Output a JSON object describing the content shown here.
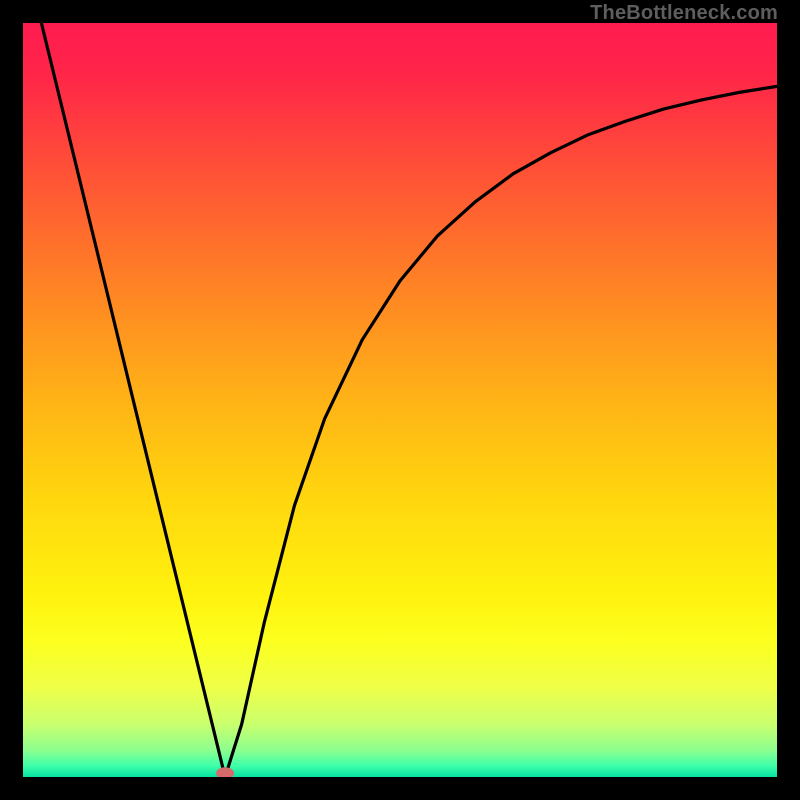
{
  "watermark": "TheBottleneck.com",
  "chart_data": {
    "type": "line",
    "title": "",
    "xlabel": "",
    "ylabel": "",
    "xlim": [
      0,
      1
    ],
    "ylim": [
      0,
      1
    ],
    "grid": false,
    "series": [
      {
        "name": "bottleneck-curve",
        "x": [
          0.0,
          0.05,
          0.1,
          0.15,
          0.2,
          0.25,
          0.268,
          0.29,
          0.32,
          0.36,
          0.4,
          0.45,
          0.5,
          0.55,
          0.6,
          0.65,
          0.7,
          0.75,
          0.8,
          0.85,
          0.9,
          0.95,
          1.0
        ],
        "y": [
          1.1,
          0.895,
          0.69,
          0.484,
          0.279,
          0.074,
          0.0,
          0.07,
          0.205,
          0.36,
          0.475,
          0.58,
          0.658,
          0.718,
          0.763,
          0.8,
          0.828,
          0.852,
          0.87,
          0.886,
          0.898,
          0.908,
          0.916
        ]
      }
    ],
    "marker": {
      "x": 0.268,
      "y": 0.005,
      "color": "#d46a6a",
      "rx": 9,
      "ry": 6
    },
    "gradient_stops": [
      {
        "offset": 0.0,
        "color": "#ff1a4f"
      },
      {
        "offset": 0.07,
        "color": "#ff2648"
      },
      {
        "offset": 0.2,
        "color": "#ff5236"
      },
      {
        "offset": 0.35,
        "color": "#ff8324"
      },
      {
        "offset": 0.5,
        "color": "#ffb316"
      },
      {
        "offset": 0.63,
        "color": "#ffd60e"
      },
      {
        "offset": 0.76,
        "color": "#fff30e"
      },
      {
        "offset": 0.82,
        "color": "#fcff1e"
      },
      {
        "offset": 0.88,
        "color": "#efff47"
      },
      {
        "offset": 0.93,
        "color": "#c9ff6e"
      },
      {
        "offset": 0.965,
        "color": "#8bff8f"
      },
      {
        "offset": 0.985,
        "color": "#3effa9"
      },
      {
        "offset": 1.0,
        "color": "#06e2a2"
      }
    ]
  }
}
